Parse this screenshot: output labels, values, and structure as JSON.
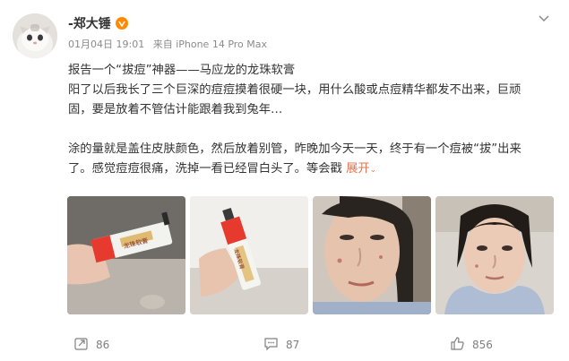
{
  "post": {
    "username": "-郑大锤",
    "date": "01月04日 19:01",
    "source": "来自 iPhone 14 Pro Max",
    "line1": "报告一个“拔痘”神器——马应龙的龙珠软膏",
    "line2": "阳了以后我长了三个巨深的痘痘摸着很硬一块，用什么酸或点痘精华都发不出来，巨顽",
    "line3": "固，要是放着不管估计能跟着我到兔年…",
    "line4": "涂的量就是盖住皮肤颜色，然后放着别管，昨晚加今天一天，终于有一个痘被“拔”出来",
    "line5": "了。感觉痘痘很痛，洗掉一看已经冒白头了。等会戳",
    "expand_label": "展开",
    "expand_arrow": "⌄"
  },
  "images": {
    "img1_label": "龙珠软膏",
    "img2_label": "龙珠软膏"
  },
  "actions": {
    "repost_count": "86",
    "comment_count": "87",
    "like_count": "856"
  },
  "colors": {
    "accent": "#eb7350",
    "meta_text": "#8a8a8a",
    "vip": "#ff8a00"
  },
  "icons": {
    "menu": "chevron-down-icon",
    "vip": "vip-badge-icon",
    "repost": "repost-icon",
    "comment": "comment-icon",
    "like": "thumbs-up-icon"
  }
}
